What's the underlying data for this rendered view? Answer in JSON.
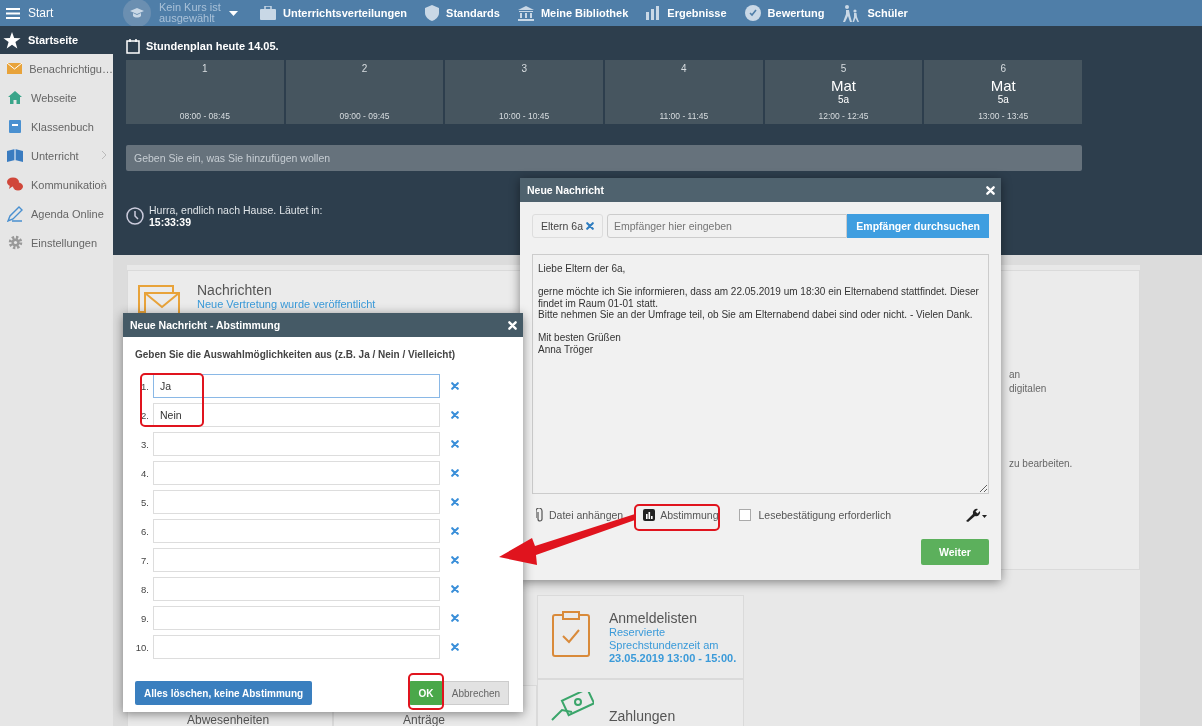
{
  "top_bar": {
    "title": "Start",
    "course_selector": "Kein Kurs ist ausgewählt",
    "nav": [
      {
        "label": "Unterrichtsverteilungen"
      },
      {
        "label": "Standards"
      },
      {
        "label": "Meine Bibliothek"
      },
      {
        "label": "Ergebnisse"
      },
      {
        "label": "Bewertung"
      },
      {
        "label": "Schüler"
      }
    ]
  },
  "sidebar": {
    "items": [
      {
        "label": "Startseite",
        "selected": true,
        "has_submenu": false
      },
      {
        "label": "Benachrichtigu…",
        "selected": false,
        "has_submenu": false
      },
      {
        "label": "Webseite",
        "selected": false,
        "has_submenu": false
      },
      {
        "label": "Klassenbuch",
        "selected": false,
        "has_submenu": false
      },
      {
        "label": "Unterricht",
        "selected": false,
        "has_submenu": true
      },
      {
        "label": "Kommunikation",
        "selected": false,
        "has_submenu": true
      },
      {
        "label": "Agenda Online",
        "selected": false,
        "has_submenu": false
      },
      {
        "label": "Einstellungen",
        "selected": false,
        "has_submenu": false
      }
    ]
  },
  "schedule": {
    "title": "Stundenplan heute 14.05.",
    "periods": [
      {
        "number": "1",
        "time": "08:00 - 08:45"
      },
      {
        "number": "2",
        "time": "09:00 - 09:45"
      },
      {
        "number": "3",
        "time": "10:00 - 10:45"
      },
      {
        "number": "4",
        "time": "11:00 - 11:45"
      },
      {
        "number": "5",
        "subject": "Mat",
        "class": "5a",
        "time": "12:00 - 12:45"
      },
      {
        "number": "6",
        "subject": "Mat",
        "class": "5a",
        "time": "13:00 - 13:45"
      }
    ]
  },
  "quick_add": {
    "placeholder": "Geben Sie ein, was Sie hinzufügen wollen"
  },
  "bell": {
    "message": "Hurra, endlich nach Hause. Läutet in:",
    "countdown": "15:33:39"
  },
  "tiles": {
    "messages": {
      "title": "Nachrichten",
      "link": "Neue Vertretung wurde veröffentlicht"
    },
    "fragments": [
      "an",
      "digitalen",
      "zu bearbeiten."
    ],
    "signup": {
      "title": "Anmeldelisten",
      "text": "Reservierte Sprechstundenzeit am **23.05.2019 13:00 - 15:00.**"
    },
    "payments": {
      "title": "Zahlungen"
    },
    "requests": {
      "title": "Anträge"
    },
    "absences": {
      "title": "Abwesenheiten"
    }
  },
  "message_dialog": {
    "title": "Neue Nachricht",
    "recipient_chip": "Eltern 6a",
    "recipient_placeholder": "Empfänger hier eingeben",
    "search_button": "Empfänger durchsuchen",
    "body": "Liebe Eltern der 6a,\n\ngerne möchte ich Sie informieren, dass am 22.05.2019 um 18:30 ein Elternabend stattfindet. Dieser findet im Raum 01-01 statt.\nBitte nehmen Sie an der Umfrage teil, ob Sie am Elternabend dabei sind oder nicht. - Vielen Dank.\n\nMit besten Grüßen\nAnna Tröger",
    "attach": "Datei anhängen",
    "poll": "Abstimmung",
    "read_receipt": {
      "label": "Lesebestätigung erforderlich",
      "checked": false
    },
    "next_button": "Weiter"
  },
  "poll_dialog": {
    "title": "Neue Nachricht - Abstimmung",
    "instruction": "Geben Sie die Auswahlmöglichkeiten aus (z.B. Ja / Nein / Vielleicht)",
    "options": [
      {
        "number": "1.",
        "value": "Ja",
        "focused": true
      },
      {
        "number": "2.",
        "value": "Nein",
        "focused": false
      },
      {
        "number": "3.",
        "focused": false
      },
      {
        "number": "4.",
        "focused": false
      },
      {
        "number": "5.",
        "focused": false
      },
      {
        "number": "6.",
        "focused": false
      },
      {
        "number": "7.",
        "focused": false
      },
      {
        "number": "8.",
        "focused": false
      },
      {
        "number": "9.",
        "focused": false
      },
      {
        "number": "10.",
        "focused": false
      }
    ],
    "clear_button": "Alles löschen, keine Abstimmung",
    "ok_button": "OK",
    "cancel_button": "Abbrechen"
  }
}
